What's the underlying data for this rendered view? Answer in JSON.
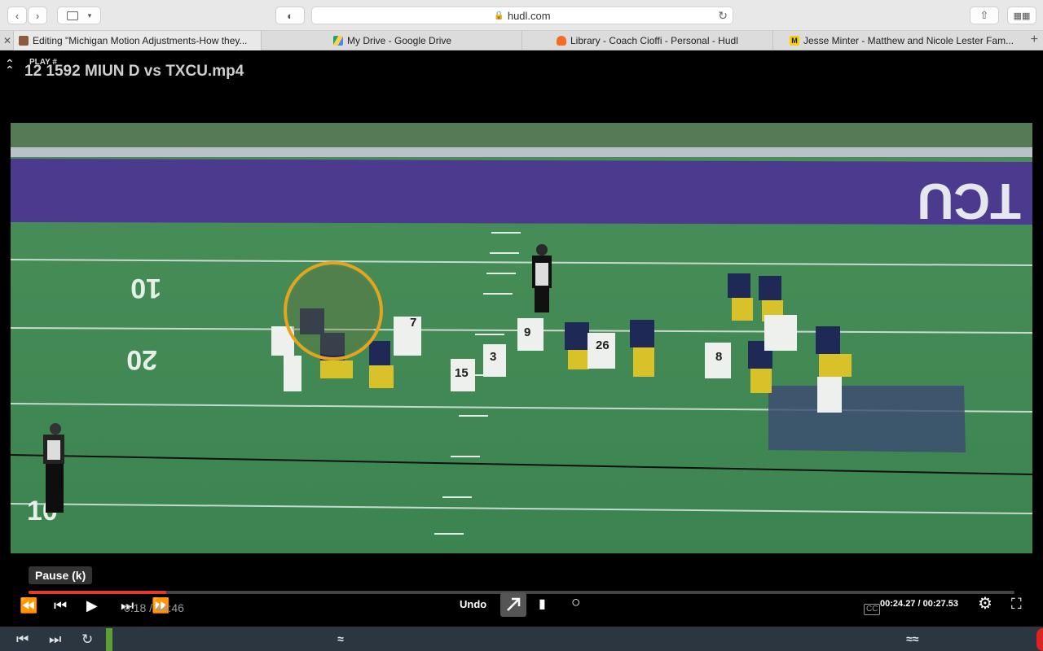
{
  "browser": {
    "url": "hudl.com",
    "tabs": [
      {
        "title": "Editing \"Michigan Motion Adjustments-How they..."
      },
      {
        "title": "My Drive - Google Drive"
      },
      {
        "title": "Library - Coach Cioffi - Personal - Hudl"
      },
      {
        "title": "Jesse Minter - Matthew and Nicole Lester Fam..."
      }
    ]
  },
  "player": {
    "play_label": "PLAY #",
    "title": "12 1592 MIUN D vs TXCU.mp4",
    "tooltip": "Pause (k)",
    "progress_pct": 14,
    "clip_time": "0:18 / 44:46",
    "undo_label": "Undo",
    "time": "00:24.27 / 00:27.53"
  },
  "video": {
    "field_text": "TCU",
    "yard_labels": [
      "10",
      "20",
      "10"
    ],
    "jersey_numbers": [
      "15",
      "3",
      "9",
      "8",
      "7",
      "26"
    ]
  },
  "colors": {
    "accent": "#e23a2b",
    "highlight_circle": "#e8a21b",
    "field": "#3f8a52",
    "endzone": "#4c3a8f"
  }
}
